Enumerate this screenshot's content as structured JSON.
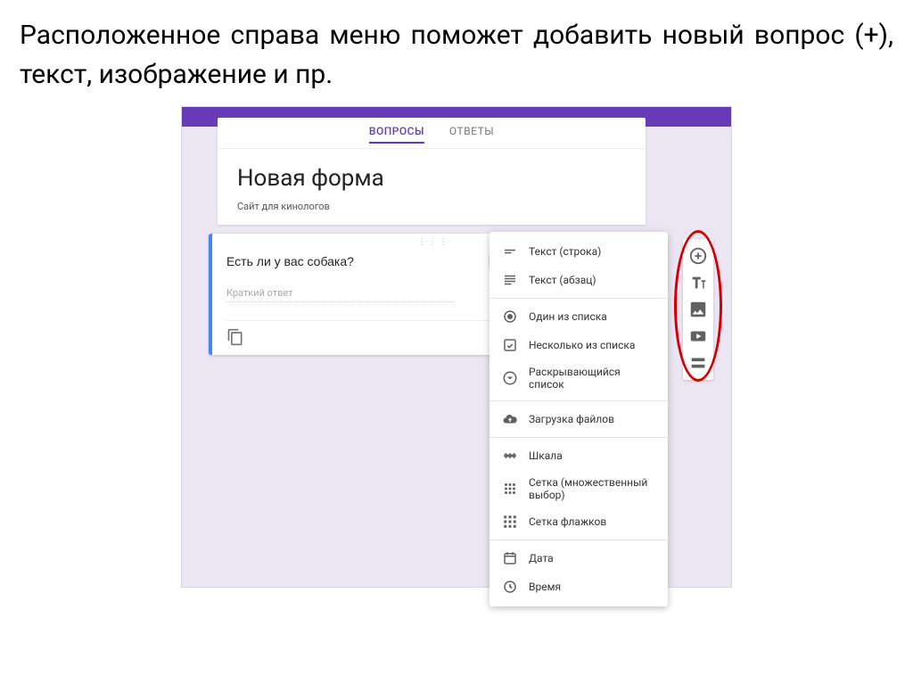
{
  "caption": "Расположенное справа меню поможет добавить новый вопрос (+), текст, изображение и пр.",
  "tabs": {
    "questions": "ВОПРОСЫ",
    "answers": "ОТВЕТЫ"
  },
  "form": {
    "title": "Новая форма",
    "description": "Сайт для кинологов"
  },
  "question": {
    "title_value": "Есть ли у вас собака?",
    "answer_placeholder": "Краткий ответ"
  },
  "dropdown": {
    "items": [
      {
        "label": "Текст (строка)",
        "icon": "short-text-icon"
      },
      {
        "label": "Текст (абзац)",
        "icon": "long-text-icon"
      },
      {
        "divider": true
      },
      {
        "label": "Один из списка",
        "icon": "radio-icon"
      },
      {
        "label": "Несколько из списка",
        "icon": "checkbox-icon"
      },
      {
        "label": "Раскрывающийся список",
        "icon": "dropdown-icon"
      },
      {
        "divider": true
      },
      {
        "label": "Загрузка файлов",
        "icon": "upload-icon"
      },
      {
        "divider": true
      },
      {
        "label": "Шкала",
        "icon": "scale-icon"
      },
      {
        "label": "Сетка (множественный выбор)",
        "icon": "grid-radio-icon"
      },
      {
        "label": "Сетка флажков",
        "icon": "grid-check-icon"
      },
      {
        "divider": true
      },
      {
        "label": "Дата",
        "icon": "date-icon"
      },
      {
        "label": "Время",
        "icon": "time-icon"
      }
    ]
  },
  "side_toolbar": [
    {
      "name": "add-question-button",
      "icon": "plus-circle-icon"
    },
    {
      "name": "add-title-button",
      "icon": "title-text-icon"
    },
    {
      "name": "add-image-button",
      "icon": "image-icon"
    },
    {
      "name": "add-video-button",
      "icon": "video-icon"
    },
    {
      "name": "add-section-button",
      "icon": "section-icon"
    }
  ]
}
